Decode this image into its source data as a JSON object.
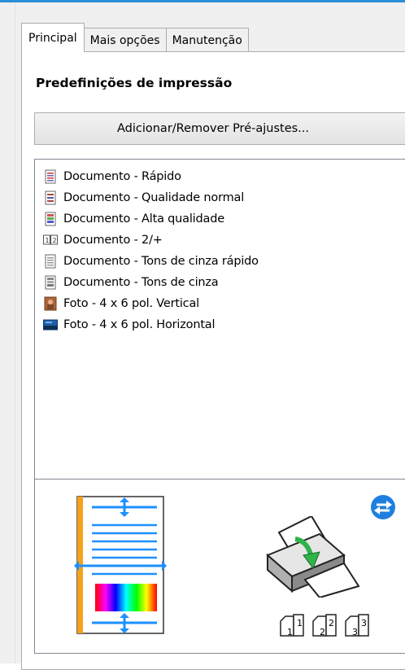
{
  "tabs": [
    {
      "label": "Principal",
      "active": true
    },
    {
      "label": "Mais opções",
      "active": false
    },
    {
      "label": "Manutenção",
      "active": false
    }
  ],
  "section_title": "Predefinições de impressão",
  "preset_button_label": "Adicionar/Remover Pré-ajustes...",
  "presets": [
    {
      "label": "Documento - Rápido",
      "icon": "document-fast-icon"
    },
    {
      "label": "Documento - Qualidade normal",
      "icon": "document-normal-icon"
    },
    {
      "label": "Documento - Alta qualidade",
      "icon": "document-high-icon"
    },
    {
      "label": "Documento - 2/+",
      "icon": "two-up-icon"
    },
    {
      "label": "Documento - Tons de cinza rápido",
      "icon": "document-gray-fast-icon"
    },
    {
      "label": "Documento - Tons de cinza",
      "icon": "document-gray-icon"
    },
    {
      "label": "Foto - 4 x 6 pol. Vertical",
      "icon": "photo-portrait-icon"
    },
    {
      "label": "Foto - 4 x 6 pol. Horizontal",
      "icon": "photo-landscape-icon"
    }
  ],
  "copy_labels": [
    "1",
    "2",
    "3"
  ],
  "colors": {
    "accent_blue": "#2b8fd8",
    "arrow_blue": "#1e90ff",
    "page_orange": "#f7a21b",
    "green_arrow": "#2fb34a"
  }
}
